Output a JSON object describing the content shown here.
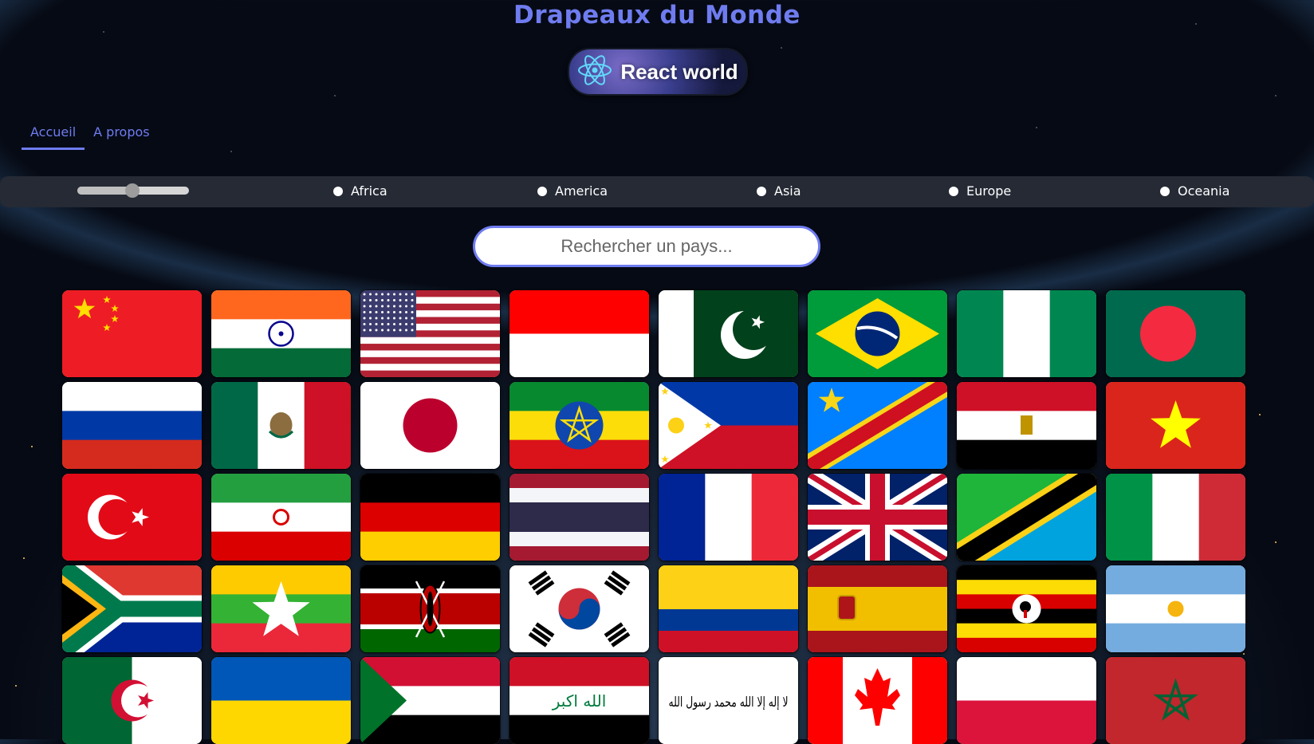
{
  "header": {
    "title": "Drapeaux du Monde",
    "logo_text": "React world",
    "logo_icon": "react-atom-icon"
  },
  "nav": {
    "tabs": [
      {
        "label": "Accueil",
        "active": true
      },
      {
        "label": "A propos",
        "active": false
      }
    ]
  },
  "filters": {
    "range_value_fraction": 0.45,
    "regions": [
      "Africa",
      "America",
      "Asia",
      "Europe",
      "Oceania"
    ]
  },
  "search": {
    "placeholder": "Rechercher un pays...",
    "value": ""
  },
  "flags": [
    "china",
    "india",
    "united-states",
    "indonesia",
    "pakistan",
    "brazil",
    "nigeria",
    "bangladesh",
    "russia",
    "mexico",
    "japan",
    "ethiopia",
    "philippines",
    "dr-congo",
    "egypt",
    "vietnam",
    "turkey",
    "iran",
    "germany",
    "thailand",
    "france",
    "united-kingdom",
    "tanzania",
    "italy",
    "south-africa",
    "myanmar",
    "kenya",
    "south-korea",
    "colombia",
    "spain",
    "uganda",
    "argentina",
    "algeria",
    "ukraine",
    "sudan",
    "iraq",
    "afghanistan",
    "canada",
    "poland",
    "morocco"
  ],
  "flag_texts": {
    "iraq": "الله اكبر",
    "afghanistan": "لا إله إلا الله محمد رسول الله"
  },
  "colors": {
    "accent": "#6f7cf0",
    "bar": "#252a35"
  }
}
